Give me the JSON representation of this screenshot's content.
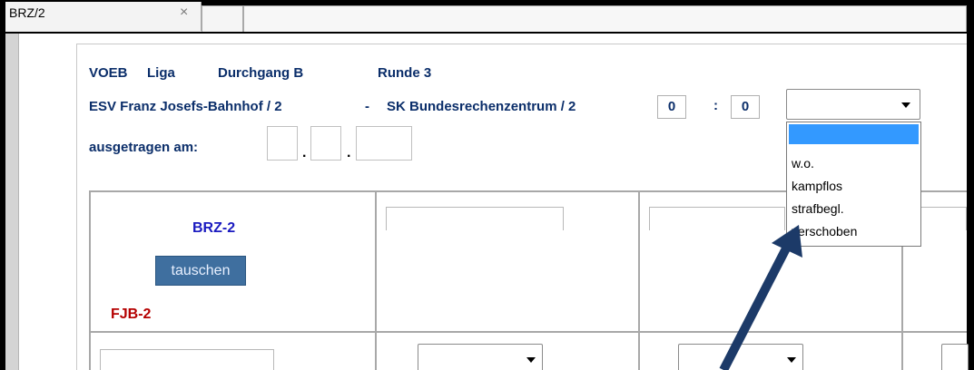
{
  "tab": {
    "title": "BRZ/2",
    "close_glyph": "×"
  },
  "header": {
    "league_org": "VOEB",
    "league": "Liga",
    "pass": "Durchgang B",
    "round": "Runde 3",
    "home_team": "ESV Franz Josefs-Bahnhof / 2",
    "separator": "-",
    "away_team": "SK Bundesrechenzentrum / 2",
    "score_home": "0",
    "score_colon": ":",
    "score_away": "0",
    "date_label": "ausgetragen am:",
    "date_dot": "."
  },
  "result_select": {
    "selected": "",
    "options": [
      "",
      "w.o.",
      "kampflos",
      "strafbegl.",
      "verschoben"
    ],
    "highlight_color": "#3399ff"
  },
  "board": {
    "top_team": "BRZ-2",
    "swap_button": "tauschen",
    "bottom_team": "FJB-2"
  },
  "colors": {
    "header_text": "#0b2e6a",
    "top_team": "#1a1ac0",
    "bottom_team": "#b50000",
    "swap_button_bg": "#3f6f9f",
    "arrow": "#1c3a68"
  },
  "icons": {
    "close": "close-icon",
    "dropdown": "chevron-down-icon",
    "annotation": "arrow-annotation"
  }
}
